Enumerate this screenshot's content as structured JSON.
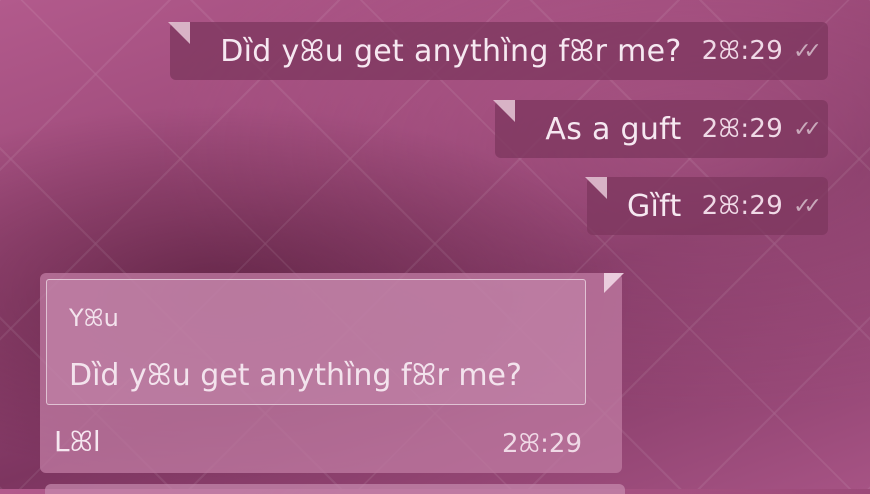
{
  "messages_out": [
    {
      "text": "Dȉd yꕤu get anythȉng fꕤr me?",
      "time": "2ꕤ:29",
      "status": "✓✓"
    },
    {
      "text": "As a guft",
      "time": "2ꕤ:29",
      "status": "✓✓"
    },
    {
      "text": "Gȉft",
      "time": "2ꕤ:29",
      "status": "✓✓"
    }
  ],
  "incoming": {
    "quote_author": "Yꕤu",
    "quote_text": "Dȉd yꕤu get anythȉng fꕤr me?",
    "text": "Lꕤl",
    "time": "2ꕤ:29"
  }
}
